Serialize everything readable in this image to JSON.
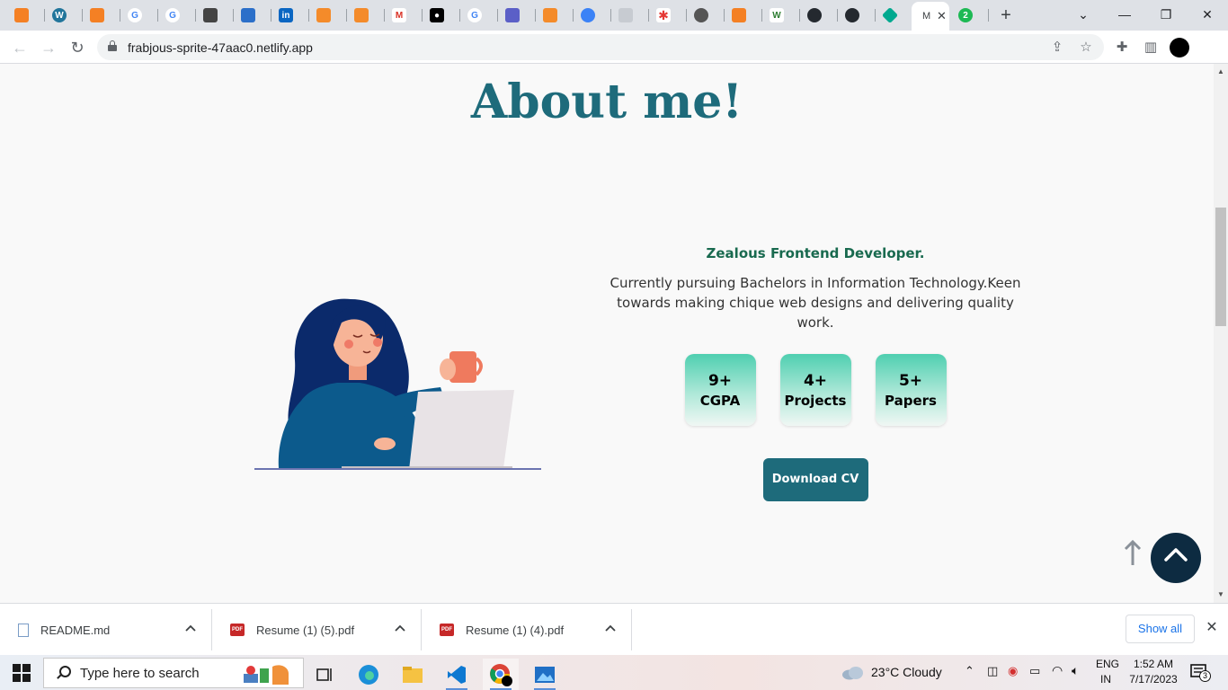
{
  "browser": {
    "active_tab_title": "M",
    "address": "frabjous-sprite-47aac0.netlify.app"
  },
  "page": {
    "heading": "About me!",
    "subtitle": "Zealous Frontend Developer.",
    "description": "Currently pursuing Bachelors in Information Technology.Keen towards making chique web designs and delivering quality work.",
    "stats": [
      {
        "value": "9+",
        "label": "CGPA"
      },
      {
        "value": "4+",
        "label": "Projects"
      },
      {
        "value": "5+",
        "label": "Papers"
      }
    ],
    "cta": "Download CV"
  },
  "downloads": {
    "items": [
      {
        "name": "README.md",
        "type": "md"
      },
      {
        "name": "Resume (1) (5).pdf",
        "type": "pdf"
      },
      {
        "name": "Resume (1) (4).pdf",
        "type": "pdf"
      }
    ],
    "show_all": "Show all"
  },
  "taskbar": {
    "search_placeholder": "Type here to search",
    "weather": "23°C  Cloudy",
    "lang_top": "ENG",
    "lang_bottom": "IN",
    "time": "1:52 AM",
    "date": "7/17/2023",
    "notifications": "3"
  },
  "colors": {
    "heading": "#1e6b7b",
    "subtitle": "#196a4f",
    "button": "#1e6b7b",
    "scroll_top": "#0d2b41"
  }
}
